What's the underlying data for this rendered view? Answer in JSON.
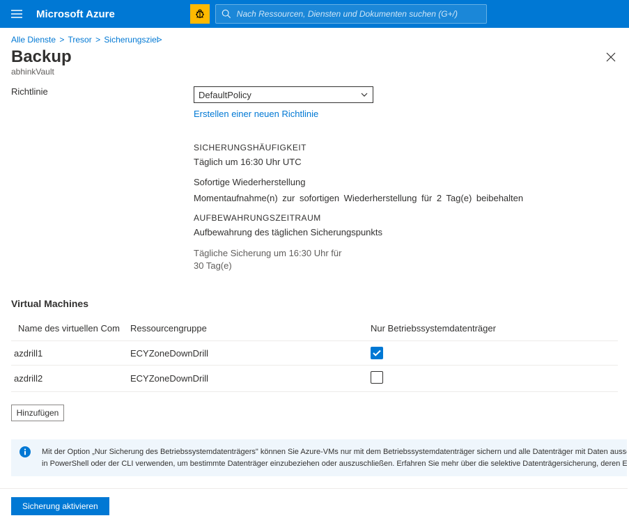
{
  "header": {
    "brand": "Microsoft Azure",
    "search_placeholder": "Nach Ressourcen, Diensten und Dokumenten suchen (G+/)"
  },
  "breadcrumb": {
    "items": [
      "Alle Dienste",
      "Tresor",
      "Sicherungsziel"
    ]
  },
  "title": "Backup",
  "subtitle": "abhinkVault",
  "form": {
    "policy_label": "Richtlinie",
    "policy_value": "DefaultPolicy",
    "create_link": "Erstellen einer neuen Richtlinie"
  },
  "policy": {
    "freq_heading": "SICHERUNGSHÄUFIGKEIT",
    "freq_value": "Täglich um 16:30 Uhr UTC",
    "instant_label": "Sofortige Wiederherstellung",
    "instant_value": "Momentaufnahme(n) zur sofortigen Wiederherstellung für 2 Tag(e) beibehalten",
    "retention_heading": "AUFBEWAHRUNGSZEITRAUM",
    "retention_label": "Aufbewahrung des täglichen Sicherungspunkts",
    "retention_value": "Tägliche Sicherung um 16:30 Uhr für 30 Tag(e)"
  },
  "vm_section": "Virtual Machines",
  "table": {
    "headers": {
      "name": "Name des virtuellen Com",
      "rg": "Ressourcengruppe",
      "osdisk": "Nur Betriebssystemdatenträger"
    },
    "rows": [
      {
        "name": "azdrill1",
        "rg": "ECYZoneDownDrill",
        "os_only": true
      },
      {
        "name": "azdrill2",
        "rg": "ECYZoneDownDrill",
        "os_only": false
      }
    ]
  },
  "add_button": "Hinzufügen",
  "info": {
    "line1": "Mit der Option „Nur Sicherung des Betriebssystemdatenträgers\" können Sie Azure-VMs nur mit dem Betriebssystemdatenträger sichern und alle Datenträger mit Daten ausschließen. Sie können die se",
    "line2": "in PowerShell oder der CLI verwenden, um bestimmte Datenträger einzubeziehen oder auszuschließen. Erfahren Sie mehr über die selektive Datenträgersicherung, deren Eins"
  },
  "footer": {
    "enable": "Sicherung aktivieren"
  }
}
